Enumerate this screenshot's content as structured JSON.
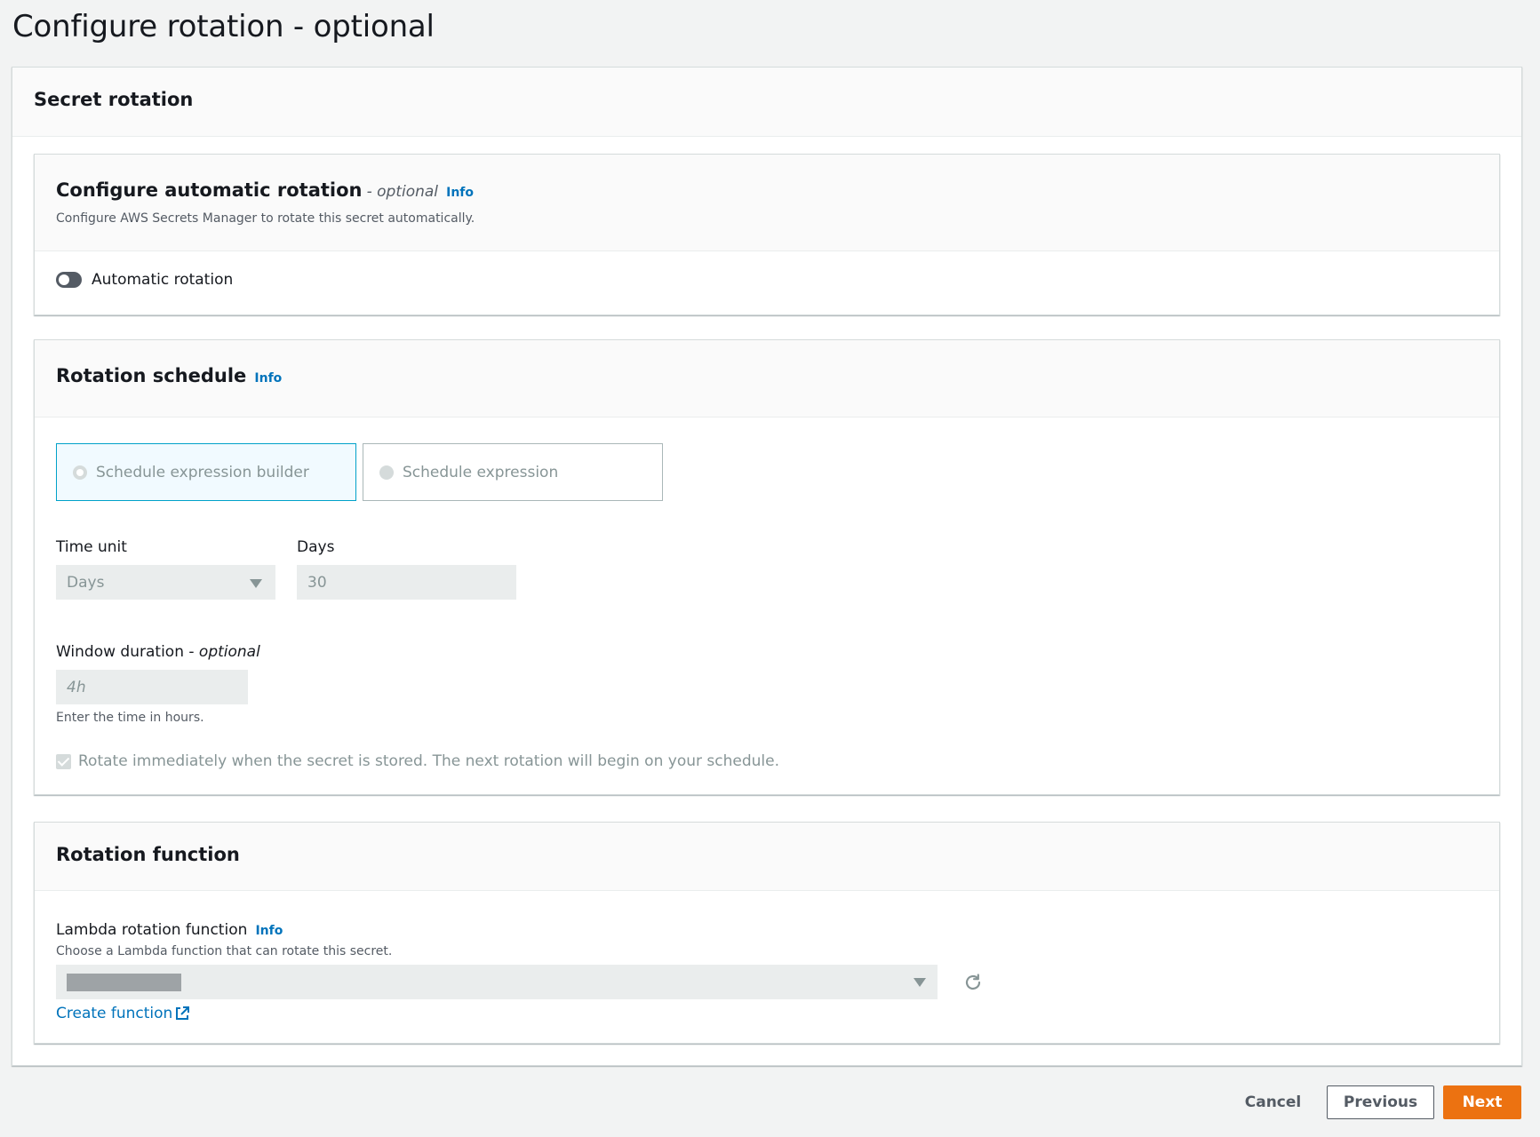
{
  "page": {
    "title": "Configure rotation - optional"
  },
  "secret_rotation": {
    "title": "Secret rotation"
  },
  "automatic": {
    "title": "Configure automatic rotation",
    "optional": "- optional",
    "info": "Info",
    "description": "Configure AWS Secrets Manager to rotate this secret automatically.",
    "toggle_label": "Automatic rotation",
    "toggle_on": false
  },
  "schedule": {
    "title": "Rotation schedule",
    "info": "Info",
    "tiles": [
      {
        "label": "Schedule expression builder",
        "selected": true
      },
      {
        "label": "Schedule expression",
        "selected": false
      }
    ],
    "time_unit": {
      "label": "Time unit",
      "value": "Days"
    },
    "days": {
      "label": "Days",
      "value": "30"
    },
    "window": {
      "label": "Window duration",
      "optional": "optional",
      "placeholder": "4h",
      "hint": "Enter the time in hours."
    },
    "rotate_immediately": {
      "label": "Rotate immediately when the secret is stored. The next rotation will begin on your schedule.",
      "checked": true
    }
  },
  "function": {
    "title": "Rotation function",
    "lambda_label": "Lambda rotation function",
    "info": "Info",
    "description": "Choose a Lambda function that can rotate this secret.",
    "create_link": "Create function"
  },
  "footer": {
    "cancel": "Cancel",
    "previous": "Previous",
    "next": "Next"
  },
  "colors": {
    "accent": "#0073bb",
    "primary_button": "#ec7211",
    "selected_tile_border": "#00a1c9"
  }
}
